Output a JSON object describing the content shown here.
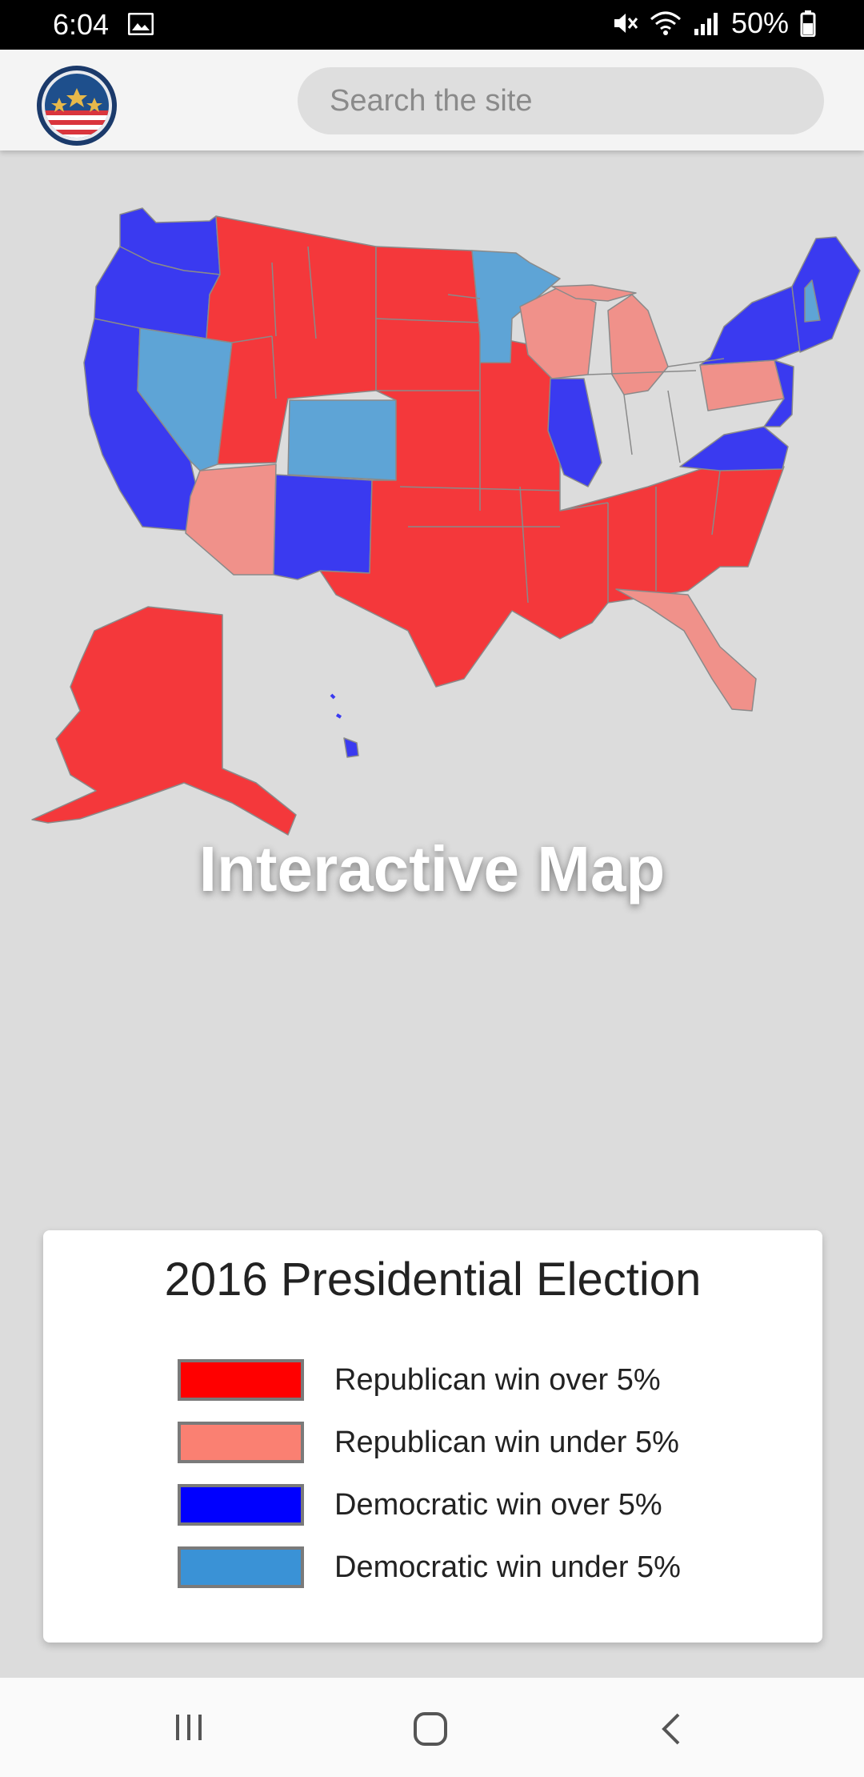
{
  "status_bar": {
    "time": "6:04",
    "battery": "50%",
    "icons": [
      "gallery-icon",
      "mute-icon",
      "wifi-icon",
      "signal-icon",
      "battery-icon"
    ]
  },
  "header": {
    "logo_icon": "stars-stripes-seal-icon",
    "search": {
      "placeholder": "Search the site",
      "value": ""
    }
  },
  "map": {
    "title": "Interactive Map",
    "colors": {
      "rep_over": "#f4383b",
      "rep_under": "#f0918a",
      "dem_over": "#3a3af0",
      "dem_under": "#5ea4d6"
    }
  },
  "legend": {
    "title": "2016 Presidential Election",
    "items": [
      {
        "label": "Republican win over 5%",
        "color": "#ff0000"
      },
      {
        "label": "Republican win under 5%",
        "color": "#fa8072"
      },
      {
        "label": "Democratic win over 5%",
        "color": "#0000ff"
      },
      {
        "label": "Democratic win under 5%",
        "color": "#3a92d6"
      }
    ]
  },
  "nav_bar": {
    "buttons": [
      "recent-apps-icon",
      "home-icon",
      "back-icon"
    ]
  }
}
